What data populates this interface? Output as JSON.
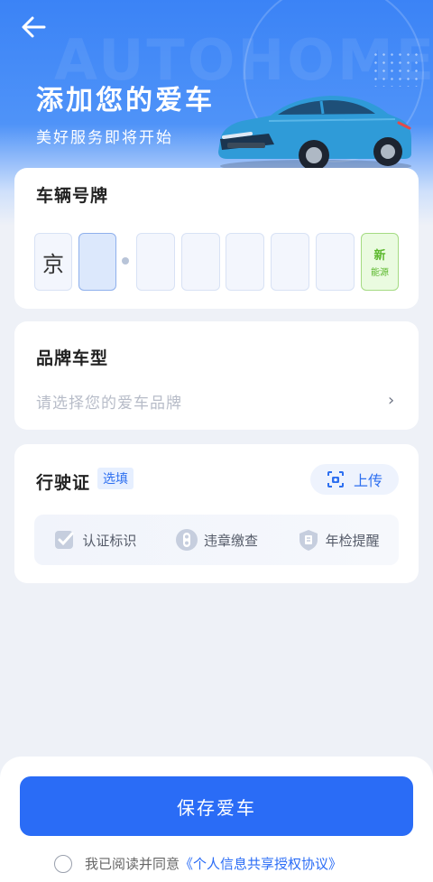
{
  "header": {
    "back_icon": "arrow-left-icon",
    "title": "添加您的爱车",
    "subtitle": "美好服务即将开始",
    "watermark": "AUTOHOME"
  },
  "plate_section": {
    "title": "车辆号牌",
    "province": "京",
    "new_energy_line1": "新",
    "new_energy_line2": "能源"
  },
  "brand_section": {
    "title": "品牌车型",
    "placeholder": "请选择您的爱车品牌",
    "chevron": "›"
  },
  "license_section": {
    "title": "行驶证",
    "optional_tag": "选填",
    "upload_label": "上传",
    "upload_icon": "camera-scan-icon",
    "features": [
      {
        "label": "认证标识",
        "icon": "verified-check-icon"
      },
      {
        "label": "违章缴查",
        "icon": "traffic-light-icon"
      },
      {
        "label": "年检提醒",
        "icon": "inspection-shield-icon"
      }
    ]
  },
  "footer": {
    "save_label": "保存爱车",
    "agree_text": "我已阅读并同意",
    "agreement_link": "《个人信息共享授权协议》"
  },
  "colors": {
    "primary": "#2a6cf6",
    "hero_blue": "#3b83f6",
    "new_energy_green": "#5cb82e",
    "background": "#eef1f7"
  }
}
